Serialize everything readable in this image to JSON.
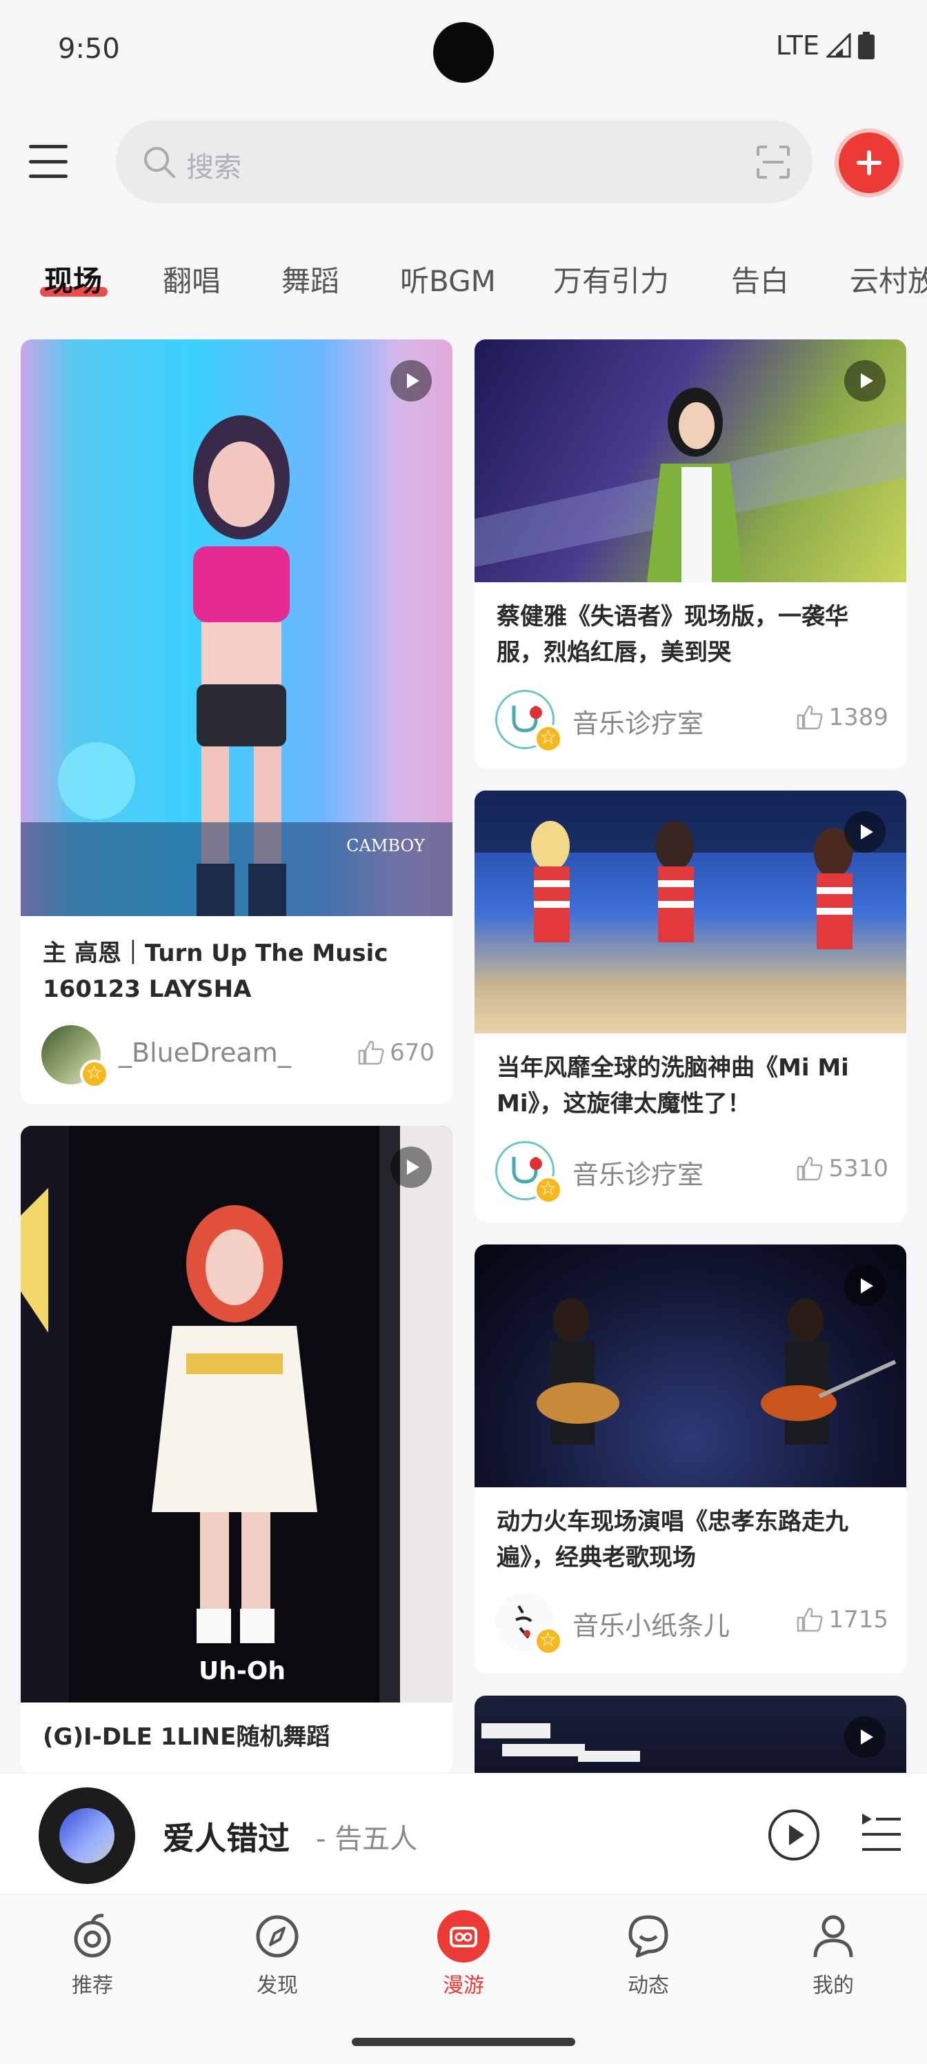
{
  "status_bar": {
    "time": "9:50",
    "network": "LTE"
  },
  "search": {
    "placeholder": "搜索"
  },
  "tabs": [
    {
      "label": "现场",
      "active": true
    },
    {
      "label": "翻唱"
    },
    {
      "label": "舞蹈"
    },
    {
      "label": "听BGM"
    },
    {
      "label": "万有引力"
    },
    {
      "label": "告白"
    },
    {
      "label": "云村放"
    }
  ],
  "cards": [
    {
      "title": "主 高恩｜Turn Up The Music 160123 LAYSHA",
      "author": "_BlueDream_",
      "likes": "670"
    },
    {
      "title": "(G)I-DLE 1LINE随机舞蹈",
      "thumb_caption": "Uh-Oh"
    },
    {
      "title": "蔡健雅《失语者》现场版，一袭华服，烈焰红唇，美到哭",
      "author": "音乐诊疗室",
      "likes": "1389"
    },
    {
      "title": "当年风靡全球的洗脑神曲《Mi Mi Mi》，这旋律太魔性了！",
      "author": "音乐诊疗室",
      "likes": "5310"
    },
    {
      "title": "动力火车现场演唱《忠孝东路走九遍》，经典老歌现场",
      "author": "音乐小纸条儿",
      "likes": "1715"
    },
    {
      "title": ""
    }
  ],
  "thumb_watermark": "CAMBOY",
  "player": {
    "song": "爱人错过",
    "artist": "- 告五人"
  },
  "nav": [
    {
      "label": "推荐",
      "icon": "recommend-icon"
    },
    {
      "label": "发现",
      "icon": "compass-icon"
    },
    {
      "label": "漫游",
      "icon": "roam-icon",
      "active": true
    },
    {
      "label": "动态",
      "icon": "chat-icon"
    },
    {
      "label": "我的",
      "icon": "profile-icon"
    }
  ],
  "colors": {
    "accent": "#ec3b36",
    "vip": "#f5b81e",
    "background": "#f6f6f8"
  }
}
